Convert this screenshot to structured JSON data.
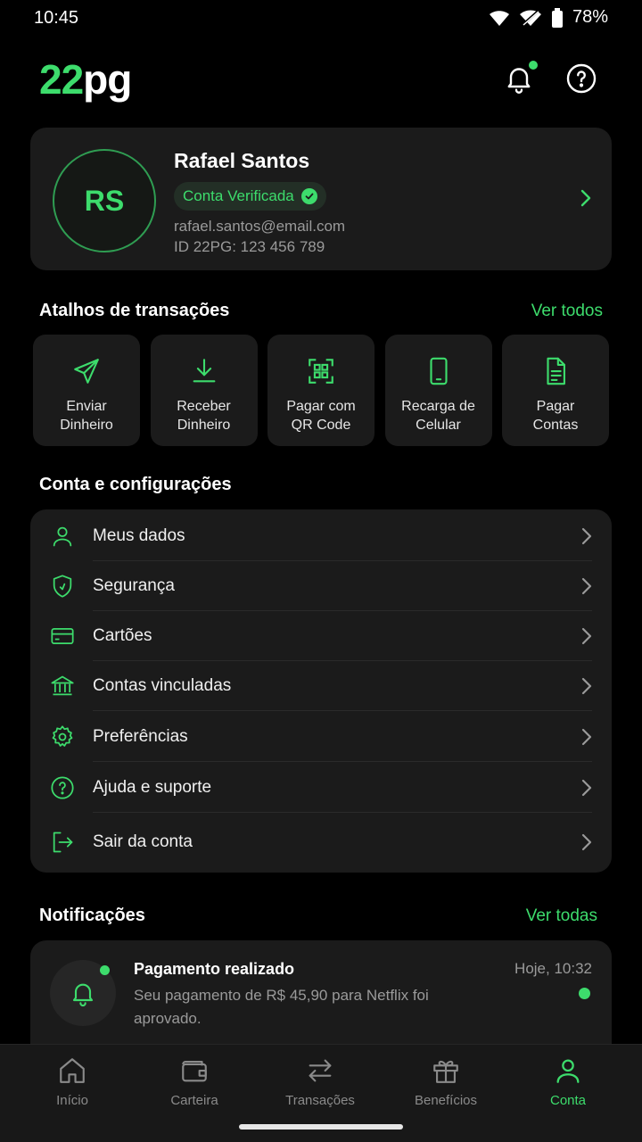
{
  "status_bar": {
    "time": "10:45",
    "battery": "78%"
  },
  "brand": {
    "logo_number": "22",
    "logo_text": "pg",
    "accent": "#3ddc6c"
  },
  "profile": {
    "initials": "RS",
    "name": "Rafael Santos",
    "badge": "Conta Verificada",
    "email": "rafael.santos@email.com",
    "id": "ID 22PG: 123 456 789"
  },
  "shortcuts": {
    "title": "Atalhos de transações",
    "link": "Ver todos",
    "items": [
      {
        "line1": "Enviar",
        "line2": "Dinheiro",
        "icon": "send-icon"
      },
      {
        "line1": "Receber",
        "line2": "Dinheiro",
        "icon": "download-icon"
      },
      {
        "line1": "Pagar com",
        "line2": "QR Code",
        "icon": "qr-code-icon"
      },
      {
        "line1": "Recarga de",
        "line2": "Celular",
        "icon": "phone-icon"
      },
      {
        "line1": "Pagar",
        "line2": "Contas",
        "icon": "document-icon"
      }
    ]
  },
  "settings": {
    "title": "Conta e configurações",
    "items": [
      {
        "label": "Meus dados",
        "icon": "user-icon"
      },
      {
        "label": "Segurança",
        "icon": "shield-icon"
      },
      {
        "label": "Cartões",
        "icon": "card-icon"
      },
      {
        "label": "Contas vinculadas",
        "icon": "bank-icon"
      },
      {
        "label": "Preferências",
        "icon": "gear-icon"
      },
      {
        "label": "Ajuda e suporte",
        "icon": "help-icon"
      },
      {
        "label": "Sair da conta",
        "icon": "logout-icon"
      }
    ]
  },
  "notifications": {
    "title": "Notificações",
    "link": "Ver todas",
    "items": [
      {
        "title": "Pagamento realizado",
        "time": "Hoje, 10:32",
        "body": "Seu pagamento de R$ 45,90 para Netflix foi aprovado."
      }
    ]
  },
  "nav": {
    "items": [
      {
        "label": "Início",
        "icon": "home-icon"
      },
      {
        "label": "Carteira",
        "icon": "wallet-icon"
      },
      {
        "label": "Transações",
        "icon": "transfer-icon"
      },
      {
        "label": "Benefícios",
        "icon": "gift-icon"
      },
      {
        "label": "Conta",
        "icon": "profile-icon",
        "active": true
      }
    ]
  }
}
